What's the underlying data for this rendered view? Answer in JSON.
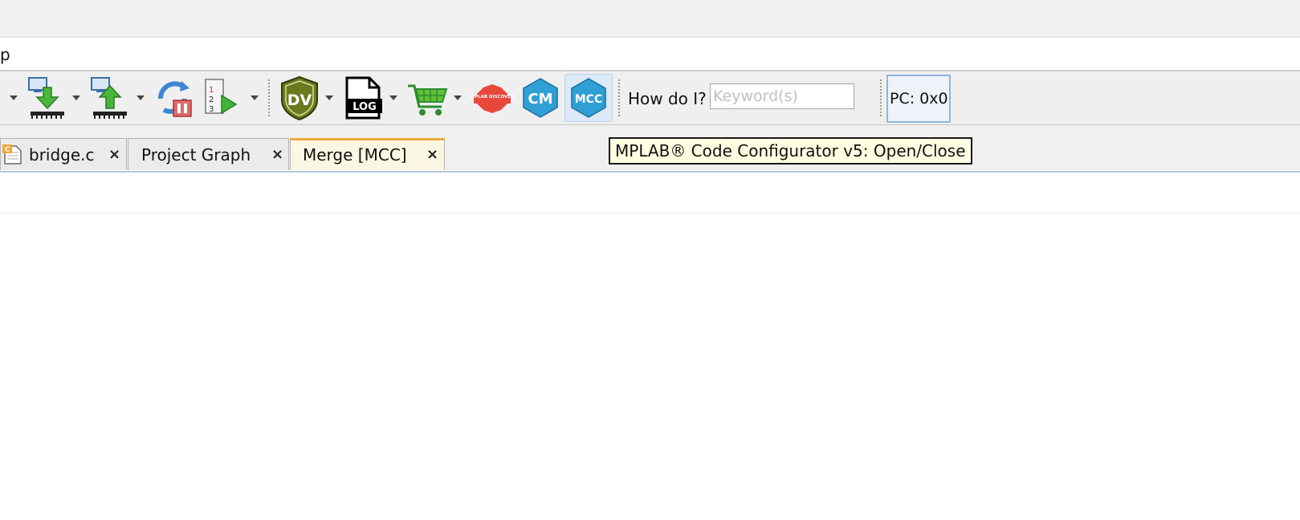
{
  "menubar": {
    "visible_fragment": "p"
  },
  "toolbar": {
    "icons": [
      "download-to-target-icon",
      "upload-from-target-icon",
      "refresh-debug-icon",
      "run-step-icon",
      "data-visualizer-icon",
      "log-icon",
      "shopping-cart-icon",
      "mplab-discover-icon",
      "content-manager-icon",
      "mplab-code-configurator-icon"
    ],
    "dv_label": "DV",
    "log_label": "LOG",
    "discover_label": "MPLAB DISCOVER",
    "cm_label": "CM",
    "mcc_label": "MCC",
    "howdoi_label": "How do I?",
    "search_placeholder": "Keyword(s)",
    "search_value": "",
    "pc_label": "PC: 0x0"
  },
  "tabs": [
    {
      "label": "bridge.c",
      "active": false,
      "icon": "c-source-file-icon"
    },
    {
      "label": "Project Graph",
      "active": false
    },
    {
      "label": "Merge [MCC]",
      "active": true
    }
  ],
  "tab_close_glyph": "×",
  "tooltip": {
    "text": "MPLAB® Code Configurator v5: Open/Close"
  },
  "colors": {
    "active_tab_accent": "#f2a93b",
    "active_tab_bg": "#fcf7e2",
    "tooltip_bg": "#ffffe1",
    "mcc_blue": "#2f9fd6",
    "dv_olive": "#6b7a1f"
  }
}
